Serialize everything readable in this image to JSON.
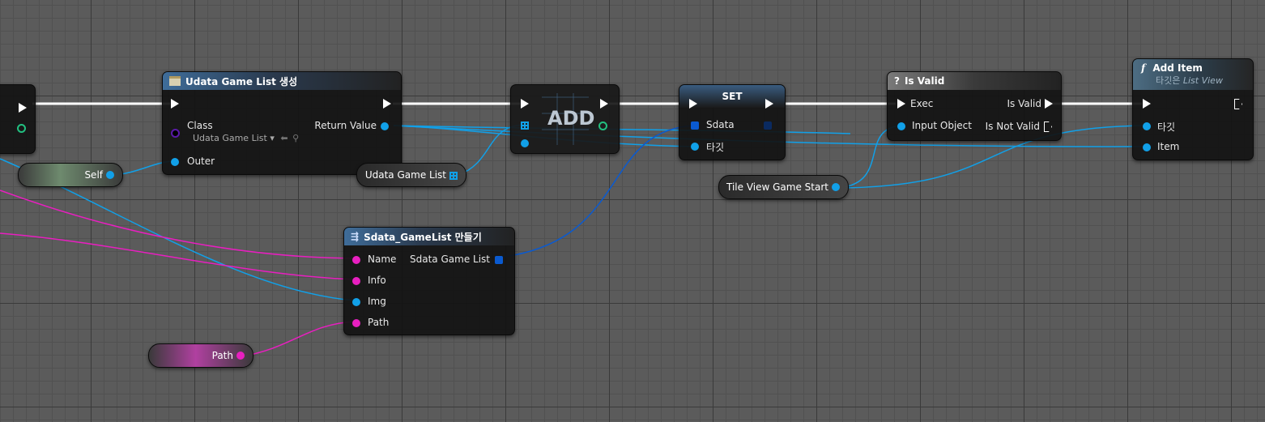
{
  "colors": {
    "exec": "#ffffff",
    "object_pin": "#11a0e8",
    "string_pin": "#e81fc0",
    "class_pin": "#5a1aa8",
    "struct_pin": "#0a5ad0",
    "array_pin": "#11a0e8"
  },
  "nodes": {
    "create_widget": {
      "title": "Udata Game List 생성",
      "class_label": "Class",
      "class_value": "Udata Game List",
      "outer_label": "Outer",
      "return_label": "Return Value"
    },
    "add": {
      "title": "ADD"
    },
    "set": {
      "title": "SET",
      "sdata_label": "Sdata",
      "target_label": "타깃"
    },
    "is_valid": {
      "title": "Is Valid",
      "exec_label": "Exec",
      "input_label": "Input Object",
      "valid_label": "Is Valid",
      "not_valid_label": "Is Not Valid"
    },
    "add_item": {
      "title": "Add Item",
      "subtitle_prefix": "타깃은",
      "subtitle_target": "List View",
      "target_label": "타깃",
      "item_label": "Item"
    },
    "make_struct": {
      "title": "Sdata_GameList 만들기",
      "name_label": "Name",
      "info_label": "Info",
      "img_label": "Img",
      "path_label": "Path",
      "output_label": "Sdata Game List"
    }
  },
  "variables": {
    "self": "Self",
    "udata_game_list": "Udata Game List",
    "tile_view": "Tile View Game Start",
    "path": "Path"
  }
}
